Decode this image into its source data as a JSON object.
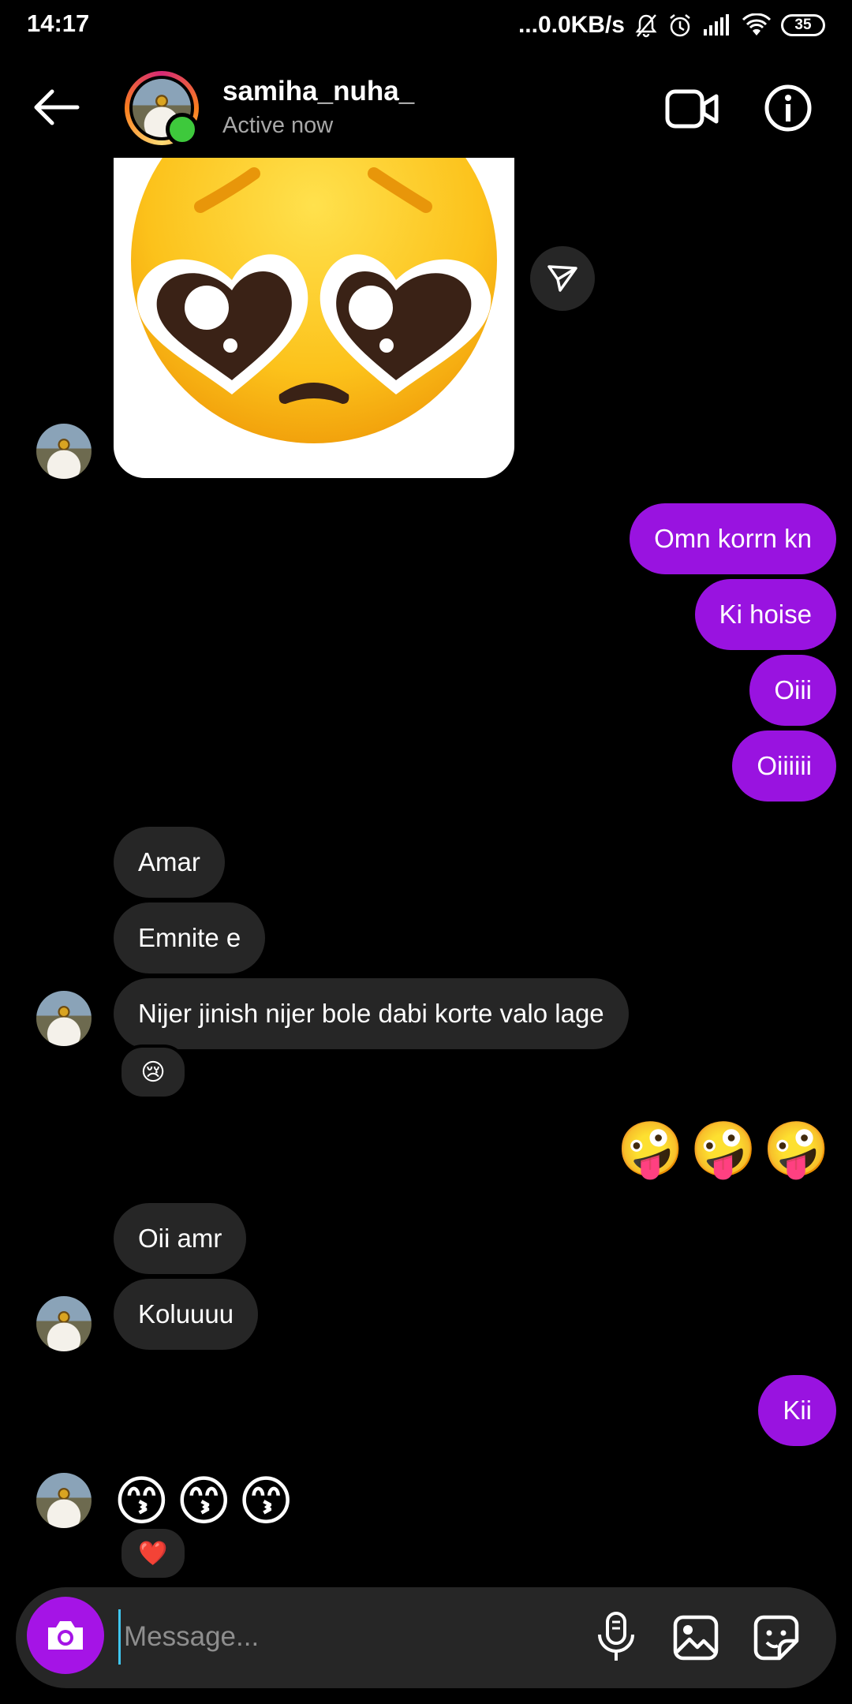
{
  "status_bar": {
    "time": "14:17",
    "net_speed": "...0.0KB/s",
    "battery": "35"
  },
  "header": {
    "username": "samiha_nuha_",
    "status": "Active now"
  },
  "messages": {
    "sent1": "Omn korrn kn",
    "sent2": "Ki hoise",
    "sent3": "Oiii",
    "sent4": "Oiiiiii",
    "recv1": "Amar",
    "recv2": "Emnite e",
    "recv3": "Nijer jinish nijer bole dabi korte valo lage",
    "recv3_reaction": "😢",
    "sent_emojis": "🤪🤪🤪",
    "recv4": "Oii amr",
    "recv5": "Koluuuu",
    "sent5": "Kii",
    "recv_emojis": "😙😙😙",
    "recv_emojis_reaction": "❤️"
  },
  "composer": {
    "placeholder": "Message..."
  },
  "colors": {
    "sent_bubble": "#9913e0",
    "received_bubble": "#262626",
    "online": "#3ec93c",
    "camera_button": "#a514e6"
  }
}
